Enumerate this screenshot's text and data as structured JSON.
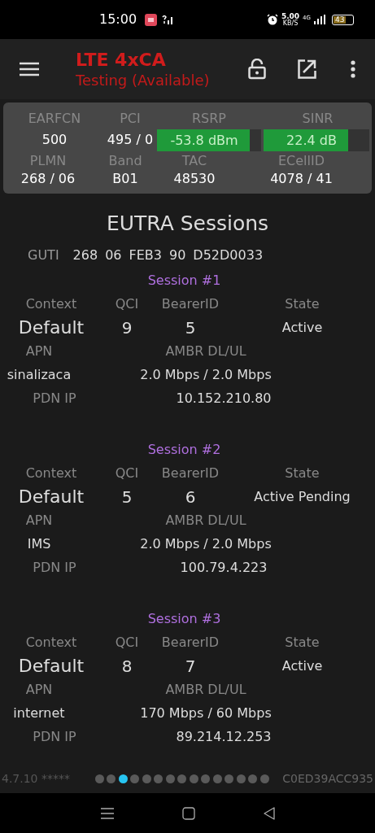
{
  "status_bar": {
    "time": "15:00",
    "speed": "5.00",
    "speed_unit": "KB/S",
    "network": "4G",
    "battery": "43"
  },
  "app_bar": {
    "title": "LTE 4xCA",
    "subtitle": "Testing (Available)"
  },
  "cell_panel": {
    "top_labels": [
      "EARFCN",
      "PCI",
      "RSRP",
      "SINR"
    ],
    "earfcn": "500",
    "pci": "495 / 0",
    "rsrp": {
      "reading": "-53.8 dBm",
      "level": 0.89
    },
    "sinr": {
      "reading": "22.4 dB",
      "level": 0.8
    },
    "bottom_labels": [
      "PLMN",
      "Band",
      "TAC",
      "ECellID"
    ],
    "bottom_values": [
      "268 / 06",
      "B01",
      "48530",
      "4078 / 41"
    ]
  },
  "section_title": "EUTRA Sessions",
  "guti": {
    "label": "GUTI",
    "values": [
      "268",
      "06",
      "FEB3",
      "90",
      "D52D0033"
    ]
  },
  "sessions": [
    {
      "title": "Session #1",
      "labels": [
        "Context",
        "QCI",
        "BearerID",
        "State"
      ],
      "context": "Default",
      "qci": "9",
      "bearer_id": "5",
      "state": "Active",
      "apn_label": "APN",
      "ambr_label": "AMBR DL/UL",
      "apn": "sinalizaca",
      "ambr": "2.0 Mbps / 2.0 Mbps",
      "ip_label": "PDN IP",
      "ip": "10.152.210.80"
    },
    {
      "title": "Session #2",
      "labels": [
        "Context",
        "QCI",
        "BearerID",
        "State"
      ],
      "context": "Default",
      "qci": "5",
      "bearer_id": "6",
      "state": "Active Pending",
      "apn_label": "APN",
      "ambr_label": "AMBR DL/UL",
      "apn": "IMS",
      "ambr": "2.0 Mbps / 2.0 Mbps",
      "ip_label": "PDN IP",
      "ip": "100.79.4.223"
    },
    {
      "title": "Session #3",
      "labels": [
        "Context",
        "QCI",
        "BearerID",
        "State"
      ],
      "context": "Default",
      "qci": "8",
      "bearer_id": "7",
      "state": "Active",
      "apn_label": "APN",
      "ambr_label": "AMBR DL/UL",
      "apn": "internet",
      "ambr": "170 Mbps / 60 Mbps",
      "ip_label": "PDN IP",
      "ip": "89.214.12.253"
    }
  ],
  "footer": {
    "version": "4.7.10 *****",
    "device_id": "C0ED39ACC935",
    "pages": [
      {
        "selected": false
      },
      {
        "selected": false
      },
      {
        "selected": true
      },
      {
        "selected": false
      },
      {
        "selected": false
      },
      {
        "selected": false
      },
      {
        "selected": false
      },
      {
        "selected": false
      },
      {
        "selected": false
      },
      {
        "selected": false
      },
      {
        "selected": false
      },
      {
        "selected": false
      },
      {
        "selected": false
      },
      {
        "selected": false
      },
      {
        "selected": false
      }
    ]
  }
}
